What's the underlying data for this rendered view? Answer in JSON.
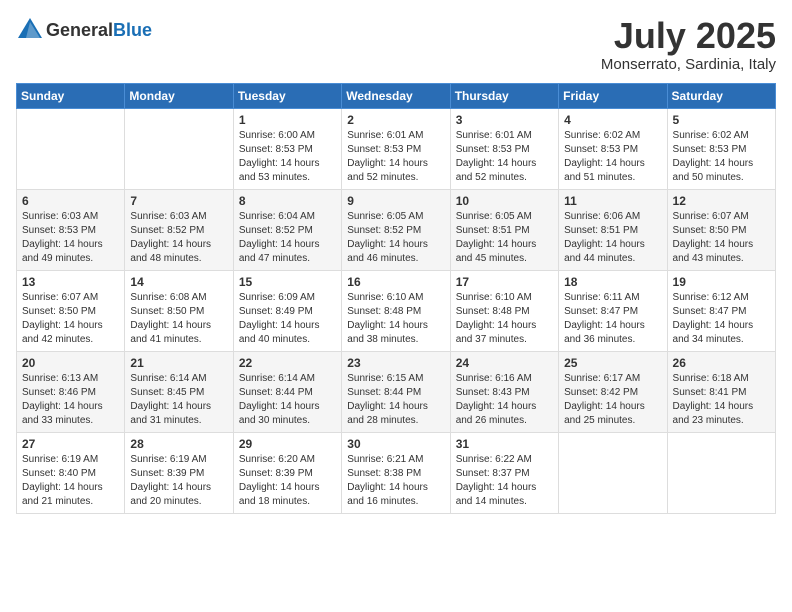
{
  "header": {
    "logo_general": "General",
    "logo_blue": "Blue",
    "month": "July 2025",
    "location": "Monserrato, Sardinia, Italy"
  },
  "weekdays": [
    "Sunday",
    "Monday",
    "Tuesday",
    "Wednesday",
    "Thursday",
    "Friday",
    "Saturday"
  ],
  "weeks": [
    [
      {
        "day": "",
        "info": ""
      },
      {
        "day": "",
        "info": ""
      },
      {
        "day": "1",
        "info": "Sunrise: 6:00 AM\nSunset: 8:53 PM\nDaylight: 14 hours and 53 minutes."
      },
      {
        "day": "2",
        "info": "Sunrise: 6:01 AM\nSunset: 8:53 PM\nDaylight: 14 hours and 52 minutes."
      },
      {
        "day": "3",
        "info": "Sunrise: 6:01 AM\nSunset: 8:53 PM\nDaylight: 14 hours and 52 minutes."
      },
      {
        "day": "4",
        "info": "Sunrise: 6:02 AM\nSunset: 8:53 PM\nDaylight: 14 hours and 51 minutes."
      },
      {
        "day": "5",
        "info": "Sunrise: 6:02 AM\nSunset: 8:53 PM\nDaylight: 14 hours and 50 minutes."
      }
    ],
    [
      {
        "day": "6",
        "info": "Sunrise: 6:03 AM\nSunset: 8:53 PM\nDaylight: 14 hours and 49 minutes."
      },
      {
        "day": "7",
        "info": "Sunrise: 6:03 AM\nSunset: 8:52 PM\nDaylight: 14 hours and 48 minutes."
      },
      {
        "day": "8",
        "info": "Sunrise: 6:04 AM\nSunset: 8:52 PM\nDaylight: 14 hours and 47 minutes."
      },
      {
        "day": "9",
        "info": "Sunrise: 6:05 AM\nSunset: 8:52 PM\nDaylight: 14 hours and 46 minutes."
      },
      {
        "day": "10",
        "info": "Sunrise: 6:05 AM\nSunset: 8:51 PM\nDaylight: 14 hours and 45 minutes."
      },
      {
        "day": "11",
        "info": "Sunrise: 6:06 AM\nSunset: 8:51 PM\nDaylight: 14 hours and 44 minutes."
      },
      {
        "day": "12",
        "info": "Sunrise: 6:07 AM\nSunset: 8:50 PM\nDaylight: 14 hours and 43 minutes."
      }
    ],
    [
      {
        "day": "13",
        "info": "Sunrise: 6:07 AM\nSunset: 8:50 PM\nDaylight: 14 hours and 42 minutes."
      },
      {
        "day": "14",
        "info": "Sunrise: 6:08 AM\nSunset: 8:50 PM\nDaylight: 14 hours and 41 minutes."
      },
      {
        "day": "15",
        "info": "Sunrise: 6:09 AM\nSunset: 8:49 PM\nDaylight: 14 hours and 40 minutes."
      },
      {
        "day": "16",
        "info": "Sunrise: 6:10 AM\nSunset: 8:48 PM\nDaylight: 14 hours and 38 minutes."
      },
      {
        "day": "17",
        "info": "Sunrise: 6:10 AM\nSunset: 8:48 PM\nDaylight: 14 hours and 37 minutes."
      },
      {
        "day": "18",
        "info": "Sunrise: 6:11 AM\nSunset: 8:47 PM\nDaylight: 14 hours and 36 minutes."
      },
      {
        "day": "19",
        "info": "Sunrise: 6:12 AM\nSunset: 8:47 PM\nDaylight: 14 hours and 34 minutes."
      }
    ],
    [
      {
        "day": "20",
        "info": "Sunrise: 6:13 AM\nSunset: 8:46 PM\nDaylight: 14 hours and 33 minutes."
      },
      {
        "day": "21",
        "info": "Sunrise: 6:14 AM\nSunset: 8:45 PM\nDaylight: 14 hours and 31 minutes."
      },
      {
        "day": "22",
        "info": "Sunrise: 6:14 AM\nSunset: 8:44 PM\nDaylight: 14 hours and 30 minutes."
      },
      {
        "day": "23",
        "info": "Sunrise: 6:15 AM\nSunset: 8:44 PM\nDaylight: 14 hours and 28 minutes."
      },
      {
        "day": "24",
        "info": "Sunrise: 6:16 AM\nSunset: 8:43 PM\nDaylight: 14 hours and 26 minutes."
      },
      {
        "day": "25",
        "info": "Sunrise: 6:17 AM\nSunset: 8:42 PM\nDaylight: 14 hours and 25 minutes."
      },
      {
        "day": "26",
        "info": "Sunrise: 6:18 AM\nSunset: 8:41 PM\nDaylight: 14 hours and 23 minutes."
      }
    ],
    [
      {
        "day": "27",
        "info": "Sunrise: 6:19 AM\nSunset: 8:40 PM\nDaylight: 14 hours and 21 minutes."
      },
      {
        "day": "28",
        "info": "Sunrise: 6:19 AM\nSunset: 8:39 PM\nDaylight: 14 hours and 20 minutes."
      },
      {
        "day": "29",
        "info": "Sunrise: 6:20 AM\nSunset: 8:39 PM\nDaylight: 14 hours and 18 minutes."
      },
      {
        "day": "30",
        "info": "Sunrise: 6:21 AM\nSunset: 8:38 PM\nDaylight: 14 hours and 16 minutes."
      },
      {
        "day": "31",
        "info": "Sunrise: 6:22 AM\nSunset: 8:37 PM\nDaylight: 14 hours and 14 minutes."
      },
      {
        "day": "",
        "info": ""
      },
      {
        "day": "",
        "info": ""
      }
    ]
  ]
}
